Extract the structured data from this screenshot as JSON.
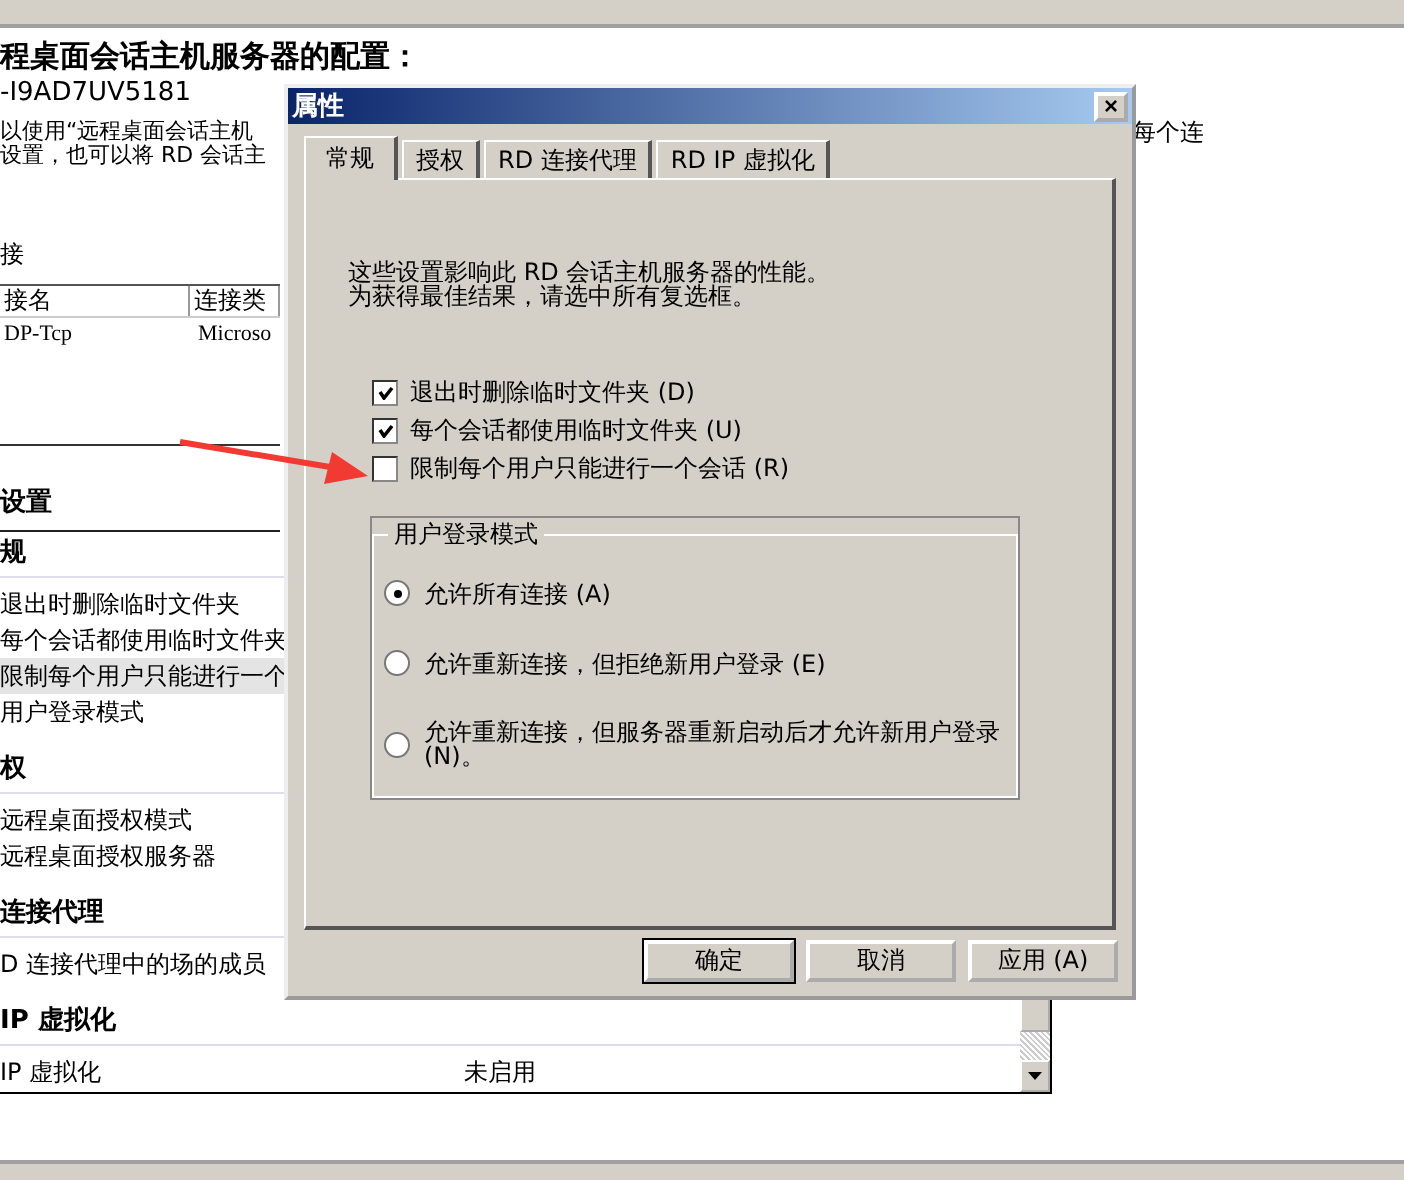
{
  "page": {
    "title": "程桌面会话主机服务器的配置：",
    "server": "-I9AD7UV5181",
    "description": [
      "以使用“远程桌面会话主机",
      "设置，也可以将 RD 会话主"
    ],
    "description_tail": "每个连"
  },
  "connections": {
    "label": "接",
    "columns": [
      "接名",
      "连接类"
    ],
    "rows": [
      [
        "DP-Tcp",
        "Microso"
      ]
    ]
  },
  "settings": {
    "title": "设置",
    "groups": [
      {
        "title": "规",
        "items": [
          {
            "name": "退出时删除临时文件夹",
            "selected": false
          },
          {
            "name": "每个会话都使用临时文件夹",
            "selected": false
          },
          {
            "name": "限制每个用户只能进行一个",
            "selected": true
          },
          {
            "name": "用户登录模式",
            "selected": false
          }
        ]
      },
      {
        "title": "权",
        "items": [
          {
            "name": "远程桌面授权模式",
            "selected": false
          },
          {
            "name": "远程桌面授权服务器",
            "selected": false
          }
        ]
      },
      {
        "title": "连接代理",
        "items": [
          {
            "name": "D 连接代理中的场的成员",
            "selected": false
          }
        ]
      },
      {
        "title": "IP 虚拟化",
        "items": [
          {
            "name": "IP 虚拟化",
            "value": "未启用",
            "selected": false
          }
        ]
      }
    ]
  },
  "dialog": {
    "title": "属性",
    "close": "×",
    "tabs": [
      {
        "label": "常规",
        "selected": true
      },
      {
        "label": "授权",
        "selected": false
      },
      {
        "label": "RD 连接代理",
        "selected": false
      },
      {
        "label": "RD IP 虚拟化",
        "selected": false
      }
    ],
    "intro": [
      "这些设置影响此 RD 会话主机服务器的性能。",
      "为获得最佳结果，请选中所有复选框。"
    ],
    "checkboxes": [
      {
        "label": "退出时删除临时文件夹 (D)",
        "checked": true
      },
      {
        "label": "每个会话都使用临时文件夹 (U)",
        "checked": true
      },
      {
        "label": "限制每个用户只能进行一个会话 (R)",
        "checked": false
      }
    ],
    "login_mode": {
      "legend": "用户登录模式",
      "options": [
        {
          "label": "允许所有连接 (A)",
          "selected": true
        },
        {
          "label": "允许重新连接，但拒绝新用户登录 (E)",
          "selected": false
        },
        {
          "label": "允许重新连接，但服务器重新启动后才允许新用户登录 (N)。",
          "selected": false
        }
      ]
    },
    "buttons": [
      {
        "label": "确定",
        "default": true
      },
      {
        "label": "取消",
        "default": false
      },
      {
        "label": "应用 (A)",
        "default": false
      }
    ]
  }
}
